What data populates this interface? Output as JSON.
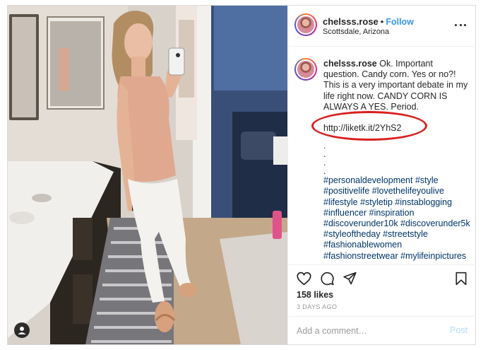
{
  "post": {
    "username": "chelsss.rose",
    "follow_label": "Follow",
    "separator": "•",
    "location": "Scottsdale, Arizona",
    "caption": {
      "username": "chelsss.rose",
      "text": "Ok. Important question. Candy corn. Yes or no?! This is a very important debate in my life right now. CANDY CORN IS ALWAYS A YES. Period.",
      "link": "http://liketk.it/2YhS2",
      "dots": ".\n.\n.\n.",
      "hashtags": "#personaldevelopment #style #positivelife #lovethelifeyoulive #lifestyle #styletip #instablogging #influencer #inspiration #discoverunder10k #discoverunder5k #styleoftheday #streetstyle #fashionablewomen #fashionstreetwear #mylifeinpictures"
    },
    "likes": "158 likes",
    "timestamp": "3 DAYS AGO",
    "comment_placeholder": "Add a comment…",
    "post_label": "Post"
  },
  "colors": {
    "follow_blue": "#3897f0",
    "hashtag_blue": "#003569",
    "highlight_red": "#d9201f",
    "post_disabled": "#b3dbff"
  },
  "icons": [
    "more-icon",
    "heart-icon",
    "comment-icon",
    "share-icon",
    "bookmark-icon",
    "user-tag-icon"
  ]
}
